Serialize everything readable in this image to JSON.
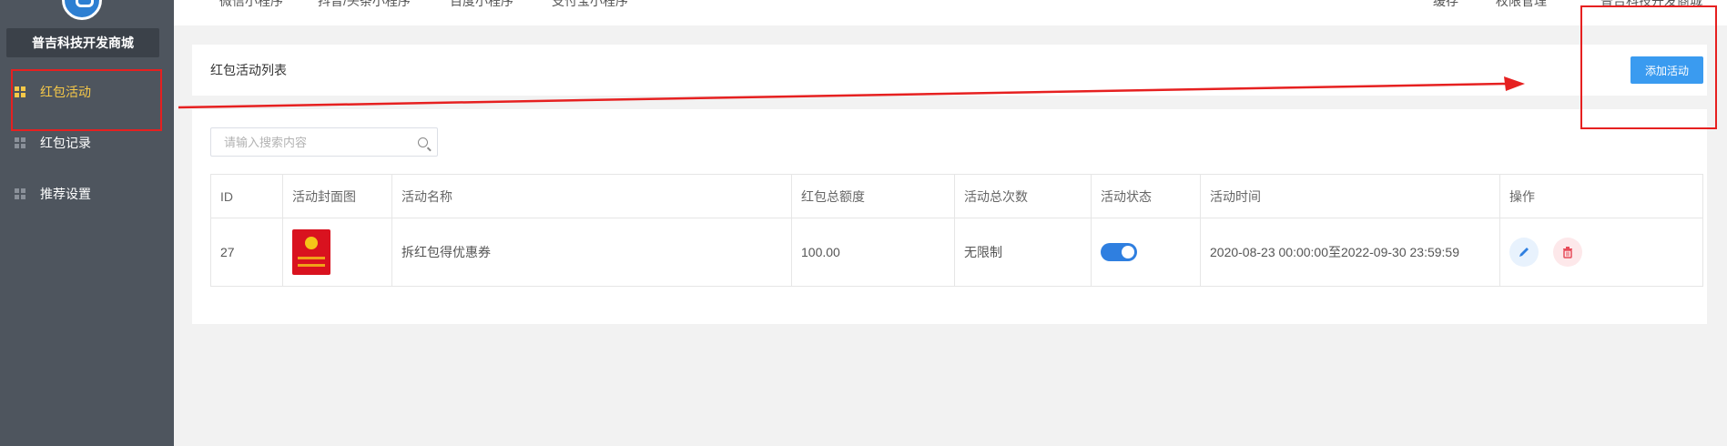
{
  "sidebar": {
    "brand": "普吉科技开发商城",
    "items": [
      {
        "label": "红包活动",
        "active": true
      },
      {
        "label": "红包记录",
        "active": false
      },
      {
        "label": "推荐设置",
        "active": false
      }
    ]
  },
  "topnav": {
    "tabs": [
      "微信小程序",
      "抖音/头条小程序",
      "百度小程序",
      "支付宝小程序"
    ],
    "right": [
      "缓存",
      "权限管理",
      "普吉科技开发商城"
    ]
  },
  "header": {
    "title": "红包活动列表",
    "add_label": "添加活动"
  },
  "search": {
    "placeholder": "请输入搜索内容"
  },
  "table": {
    "headers": [
      "ID",
      "活动封面图",
      "活动名称",
      "红包总额度",
      "活动总次数",
      "活动状态",
      "活动时间",
      "操作"
    ],
    "rows": [
      {
        "id": "27",
        "name": "拆红包得优惠券",
        "total": "100.00",
        "count": "无限制",
        "status_on": true,
        "time": "2020-08-23 00:00:00至2022-09-30 23:59:59"
      }
    ]
  },
  "colors": {
    "sidebar_bg": "#4e555e",
    "active": "#f7c948",
    "primary": "#3a9bf0",
    "annotation": "#e62020"
  }
}
